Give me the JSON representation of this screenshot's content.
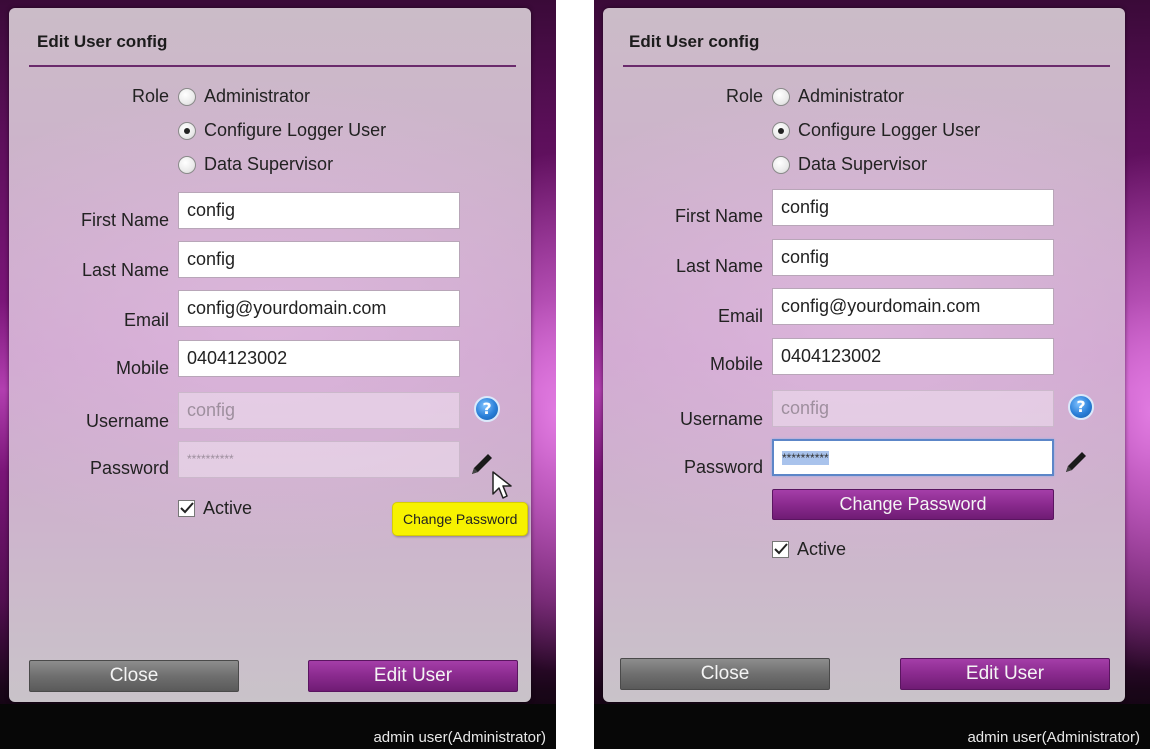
{
  "panels": [
    {
      "dialog_title": "Edit User config",
      "role_label": "Role",
      "roles": [
        {
          "label": "Administrator",
          "selected": false
        },
        {
          "label": "Configure Logger User",
          "selected": true
        },
        {
          "label": "Data Supervisor",
          "selected": false
        }
      ],
      "fields": {
        "first_name": {
          "label": "First Name",
          "value": "config"
        },
        "last_name": {
          "label": "Last Name",
          "value": "config"
        },
        "email": {
          "label": "Email",
          "value": "config@yourdomain.com"
        },
        "mobile": {
          "label": "Mobile",
          "value": "0404123002"
        },
        "username": {
          "label": "Username",
          "value": "config"
        },
        "password": {
          "label": "Password",
          "value": "**********"
        }
      },
      "active": {
        "label": "Active",
        "checked": true
      },
      "tooltip": "Change Password",
      "buttons": {
        "close": "Close",
        "edit_user": "Edit User"
      },
      "status_user": "admin user(Administrator)"
    },
    {
      "dialog_title": "Edit User config",
      "role_label": "Role",
      "roles": [
        {
          "label": "Administrator",
          "selected": false
        },
        {
          "label": "Configure Logger User",
          "selected": true
        },
        {
          "label": "Data Supervisor",
          "selected": false
        }
      ],
      "fields": {
        "first_name": {
          "label": "First Name",
          "value": "config"
        },
        "last_name": {
          "label": "Last Name",
          "value": "config"
        },
        "email": {
          "label": "Email",
          "value": "config@yourdomain.com"
        },
        "mobile": {
          "label": "Mobile",
          "value": "0404123002"
        },
        "username": {
          "label": "Username",
          "value": "config"
        },
        "password": {
          "label": "Password",
          "value": "**********"
        }
      },
      "change_password_button": "Change Password",
      "active": {
        "label": "Active",
        "checked": true
      },
      "buttons": {
        "close": "Close",
        "edit_user": "Edit User"
      },
      "status_user": "admin user(Administrator)"
    }
  ],
  "icons": {
    "help": "help-icon",
    "edit": "pencil-icon",
    "cursor": "mouse-pointer-icon"
  },
  "colors": {
    "accent_purple": "#8a2a8e",
    "tooltip_yellow": "#f7f200",
    "focus_blue": "#5c86c8"
  }
}
